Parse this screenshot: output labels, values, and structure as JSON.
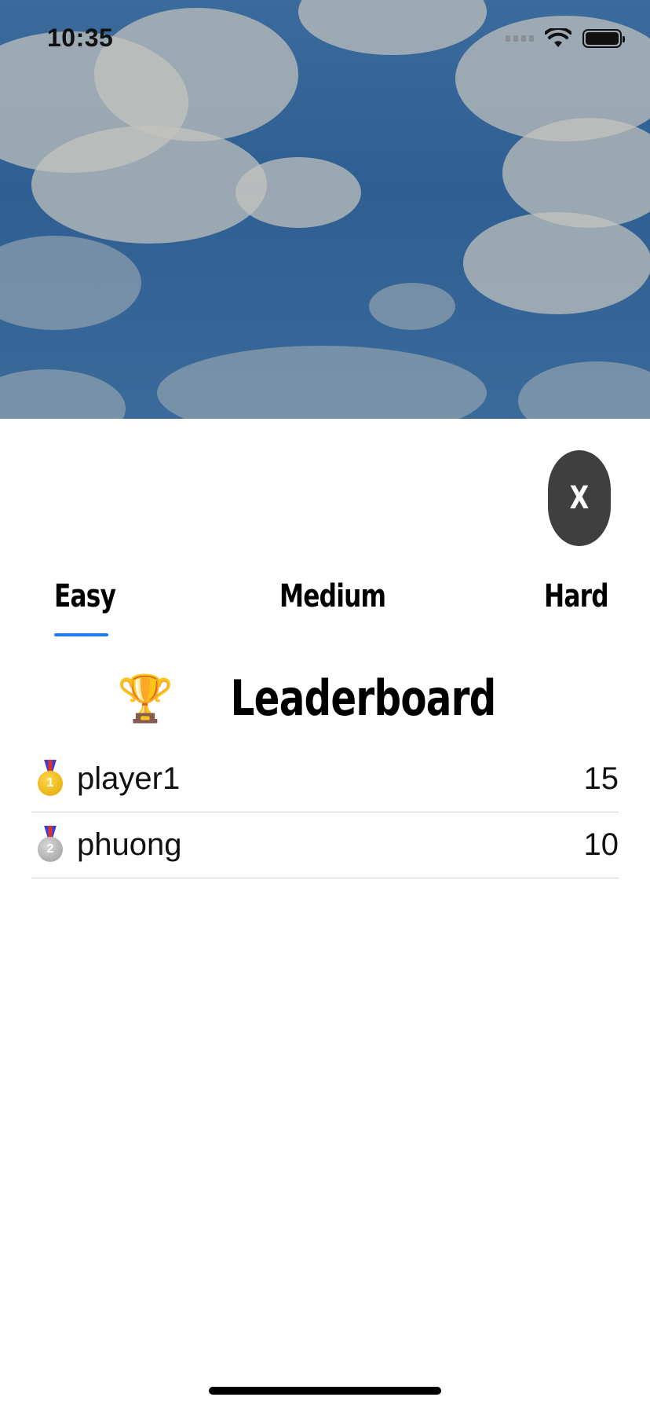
{
  "status_bar": {
    "time": "10:35",
    "icons": [
      "signal-icon",
      "wifi-icon",
      "battery-icon"
    ]
  },
  "close_button": {
    "label": "X"
  },
  "tabs": [
    {
      "label": "Easy",
      "selected": true
    },
    {
      "label": "Medium",
      "selected": false
    },
    {
      "label": "Hard",
      "selected": false
    }
  ],
  "leaderboard": {
    "icon": "trophy-icon",
    "title": "Leaderboard",
    "entries": [
      {
        "rank_icon": "gold-medal-icon",
        "rank": "1",
        "name": "player1",
        "score": "15"
      },
      {
        "rank_icon": "silver-medal-icon",
        "rank": "2",
        "name": "phuong",
        "score": "10"
      }
    ]
  },
  "colors": {
    "accent": "#1a7bef",
    "close_button_bg": "#3f3f3f",
    "sky": "#2f5f92"
  }
}
